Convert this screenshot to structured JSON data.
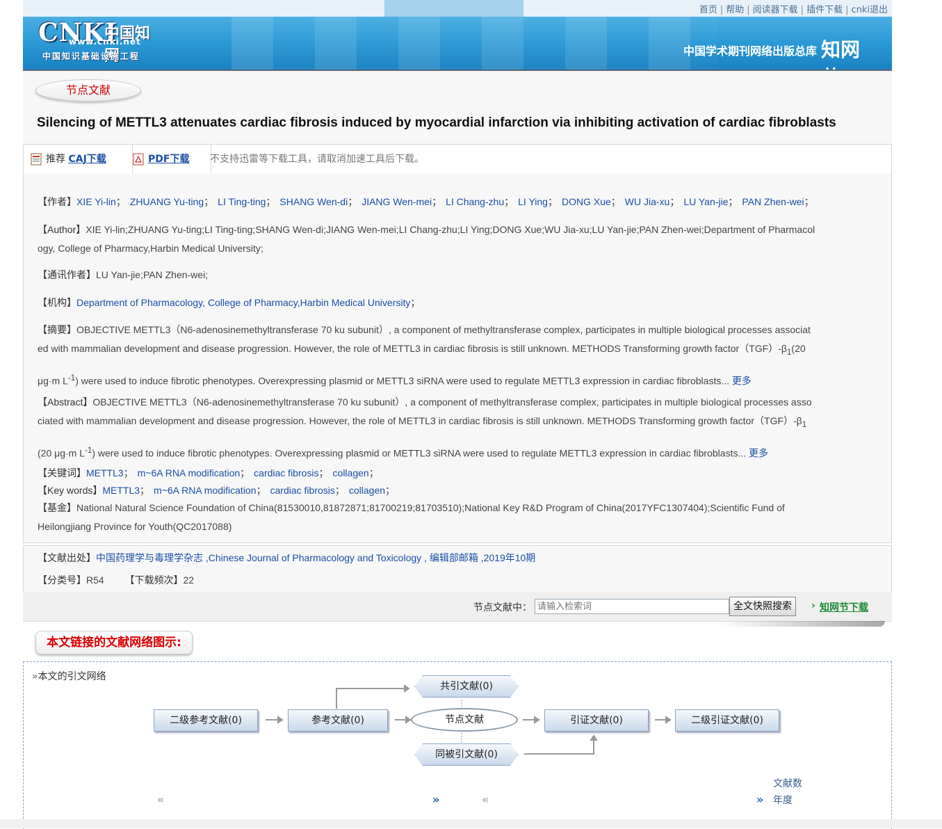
{
  "topnav": [
    "首页",
    "帮助",
    "阅读器下载",
    "插件下载",
    "cnki退出"
  ],
  "logo": {
    "brand": "CNKI",
    "cn": "中国知网",
    "url": "www.cnki.net",
    "sub": "中国知识基础设施工程"
  },
  "header_right": "中国学术期刊网络出版总库",
  "header_badge": "知网节",
  "node_label": "节点文献",
  "title": "Silencing of METTL3 attenuates cardiac fibrosis induced by myocardial infarction via inhibiting activation of cardiac fibroblasts",
  "download": {
    "recommend": "推荐",
    "caj": "CAJ下载",
    "pdf": "PDF下载",
    "note": "不支持迅雷等下载工具，请取消加速工具后下载。"
  },
  "authors_label": "【作者】",
  "authors": [
    "XIE Yi-lin",
    "ZHUANG Yu-ting",
    "LI Ting-ting",
    "SHANG Wen-di",
    "JIANG Wen-mei",
    "LI Chang-zhu",
    "LI Ying",
    "DONG Xue",
    "WU Jia-xu",
    "LU Yan-jie",
    "PAN Zhen-wei"
  ],
  "author_en_label": "【Author】",
  "author_en_line1": "XIE Yi-lin;ZHUANG Yu-ting;LI Ting-ting;SHANG Wen-di;JIANG Wen-mei;LI Chang-zhu;LI Ying;DONG Xue;WU Jia-xu;LU Yan-jie;PAN Zhen-wei;Department of Pharmacol",
  "author_en_line2": "ogy, College of Pharmacy,Harbin Medical University;",
  "corr_label": "【通讯作者】",
  "corr": "LU Yan-jie;PAN Zhen-wei;",
  "inst_label": "【机构】",
  "inst": "Department of Pharmacology, College of Pharmacy,Harbin Medical University",
  "abs_cn_label": "【摘要】",
  "abs_cn_line1": "OBJECTIVE METTL3（N6-adenosinemethyltransferase 70 ku subunit）, a component of methyltransferase complex, participates in multiple biological processes associat",
  "abs_cn_line2": "ed with mammalian development and disease progression. However, the role of METTL3 in cardiac fibrosis is still unknown. METHODS Transforming growth factor（TGF）-β",
  "abs_cn_line3": "(20",
  "abs_cn_line4a": "μg·m L",
  "abs_cn_line4b": ") were used to induce fibrotic phenotypes. Overexpressing plasmid or METTL3 siRNA were used to regulate METTL3 expression in cardiac fibroblasts...",
  "abs_en_label": "【Abstract】",
  "abs_en_line1": "OBJECTIVE METTL3（N6-adenosinemethyltransferase 70 ku subunit）, a component of methyltransferase complex, participates in multiple biological processes asso",
  "abs_en_line2": "ciated with mammalian development and disease progression. However, the role of METTL3 in cardiac fibrosis is still unknown. METHODS Transforming growth factor（TGF）-β",
  "abs_en_line4a": "(20 μg·m L",
  "abs_en_line4b": ") were used to induce fibrotic phenotypes. Overexpressing plasmid or METTL3 siRNA were used to regulate METTL3 expression in cardiac fibroblasts...",
  "more": "更多",
  "sub1": "1",
  "sup1": "-1",
  "kw_label": "【关键词】",
  "keywords": [
    "METTL3",
    "m~6A RNA modification",
    "cardiac fibrosis",
    "collagen"
  ],
  "kw_en_label": "【Key words】",
  "fund_label": "【基金】",
  "fund_line1": "National Natural Science Foundation of China(81530010,81872871;81700219;81703510);National Key R&D Program of China(2017YFC1307404);Scientific Fund of",
  "fund_line2": "Heilongjiang Province for Youth(QC2017088)",
  "source_label": "【文献出处】",
  "source": "中国药理学与毒理学杂志 ,Chinese Journal of Pharmacology and Toxicology , 编辑部邮箱 ,2019年10期",
  "class_label": "【分类号】",
  "class": "R54",
  "dl_label": "【下载频次】",
  "dl_count": "22",
  "search": {
    "label": "节点文献中：",
    "placeholder": "请输入检索词",
    "button": "全文快照搜索",
    "download": "知网节下载"
  },
  "network_title": "本文链接的文献网络图示:",
  "network_head": "本文的引文网络",
  "nodes": {
    "second_ref": "二级参考文献(0)",
    "ref": "参考文献(0)",
    "node": "节点文献",
    "cite": "引证文献(0)",
    "second_cite": "二级引证文献(0)",
    "co_cite": "共引文献(0)",
    "co_cited": "同被引文献(0)"
  },
  "legend": {
    "count": "文献数",
    "year": "年度"
  }
}
